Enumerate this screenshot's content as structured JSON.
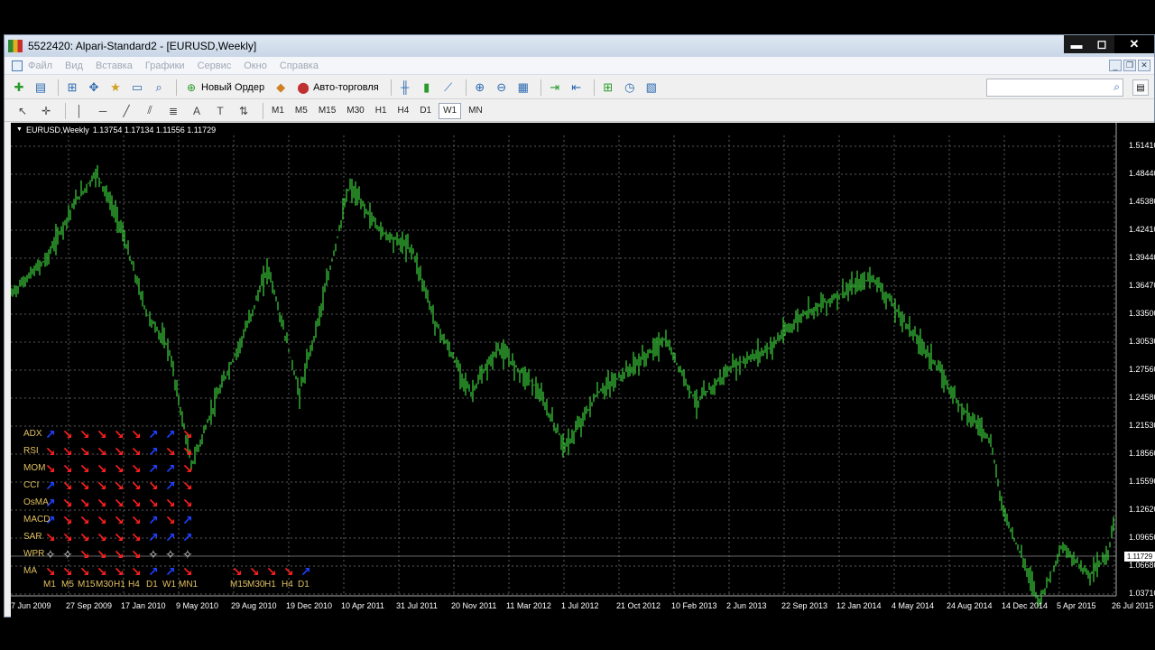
{
  "window": {
    "title": "5522420: Alpari-Standard2 - [EURUSD,Weekly]",
    "minimize": "▬",
    "maximize": "◻",
    "close": "✕"
  },
  "menu": [
    "Файл",
    "Вид",
    "Вставка",
    "Графики",
    "Сервис",
    "Окно",
    "Справка"
  ],
  "toolbar": {
    "new_order": "Новый Ордер",
    "auto_trading": "Авто-торговля",
    "search_placeholder": ""
  },
  "timeframes": [
    "M1",
    "M5",
    "M15",
    "M30",
    "H1",
    "H4",
    "D1",
    "W1",
    "MN"
  ],
  "active_timeframe": "W1",
  "chart": {
    "header_symbol": "EURUSD,Weekly",
    "header_ohlc": "1.13754 1.17134 1.11556 1.11729",
    "current_price": "1.11729",
    "price_labels": [
      "1.51410",
      "1.48440",
      "1.45380",
      "1.42410",
      "1.39440",
      "1.36470",
      "1.33500",
      "1.30530",
      "1.27560",
      "1.24580",
      "1.21530",
      "1.18560",
      "1.15590",
      "1.12620",
      "1.09650",
      "1.06680",
      "1.03710"
    ],
    "date_labels": [
      "7 Jun 2009",
      "27 Sep 2009",
      "17 Jan 2010",
      "9 May 2010",
      "29 Aug 2010",
      "19 Dec 2010",
      "10 Apr 2011",
      "31 Jul 2011",
      "20 Nov 2011",
      "11 Mar 2012",
      "1 Jul 2012",
      "21 Oct 2012",
      "10 Feb 2013",
      "2 Jun 2013",
      "22 Sep 2013",
      "12 Jan 2014",
      "4 May 2014",
      "24 Aug 2014",
      "14 Dec 2014",
      "5 Apr 2015",
      "26 Jul 2015"
    ],
    "colors": {
      "bull": "#3cd23c",
      "bg": "#000000",
      "grid": "#5a5a5a",
      "up_arrow": "#2040ff",
      "down_arrow": "#ff2020",
      "label": "#e0c060"
    }
  },
  "indicator_panel": {
    "rows": [
      "ADX",
      "RSI",
      "MOM",
      "CCI",
      "OsMA",
      "MACD",
      "SAR",
      "WPR",
      "MA"
    ],
    "timeframe_labels": [
      "M1",
      "M5",
      "M15",
      "M30",
      "H1",
      "H4",
      "D1",
      "W1",
      "MN1"
    ],
    "secondary_labels": [
      "M15",
      "M30",
      "H1",
      "H4",
      "D1"
    ],
    "signals": [
      [
        "u",
        "d",
        "d",
        "d",
        "d",
        "d",
        "u",
        "u",
        "d"
      ],
      [
        "d",
        "d",
        "d",
        "d",
        "d",
        "d",
        "u",
        "d",
        "d"
      ],
      [
        "d",
        "d",
        "d",
        "d",
        "d",
        "d",
        "u",
        "u",
        "d"
      ],
      [
        "u",
        "d",
        "d",
        "d",
        "d",
        "d",
        "d",
        "u",
        "d"
      ],
      [
        "u",
        "d",
        "d",
        "d",
        "d",
        "d",
        "d",
        "d",
        "d"
      ],
      [
        "u",
        "d",
        "d",
        "d",
        "d",
        "d",
        "u",
        "d",
        "u"
      ],
      [
        "d",
        "d",
        "d",
        "d",
        "d",
        "d",
        "u",
        "u",
        "u"
      ],
      [
        "n",
        "n",
        "d",
        "d",
        "d",
        "d",
        "n",
        "n",
        "n"
      ],
      [
        "d",
        "d",
        "d",
        "d",
        "d",
        "d",
        "u",
        "u",
        "d"
      ]
    ],
    "ma_secondary_signals": [
      "d",
      "d",
      "d",
      "d",
      "u"
    ]
  }
}
